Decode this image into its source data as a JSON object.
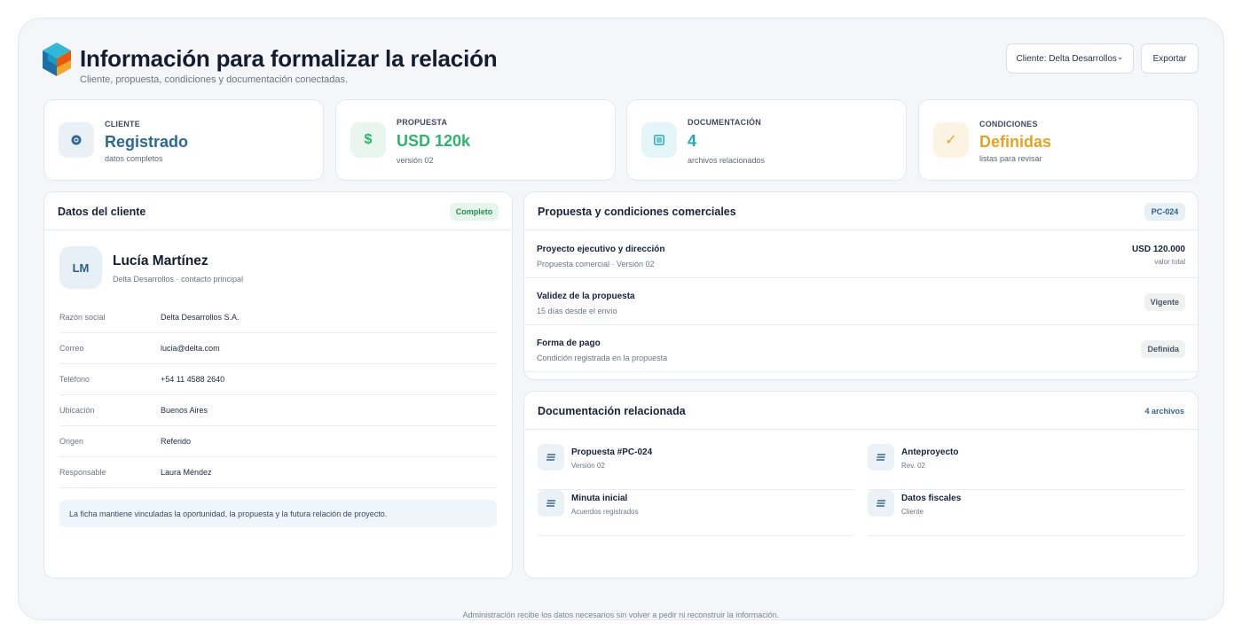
{
  "header": {
    "title": "Información para formalizar la relación",
    "subtitle": "Cliente, propuesta, condiciones y documentación conectadas.",
    "client_button": "Cliente: Delta Desarrollos",
    "client_chevron": "⌄",
    "export_button": "Exportar"
  },
  "stats": [
    {
      "label": "CLIENTE",
      "value": "Registrado",
      "sub": "datos completos",
      "icon": "eye-icon",
      "color": "#2c6a8f"
    },
    {
      "label": "PROPUESTA",
      "value": "USD 120k",
      "sub": "versión 02",
      "icon": "dollar-icon",
      "glyph": "$",
      "color": "#2db66b"
    },
    {
      "label": "DOCUMENTACIÓN",
      "value": "4",
      "sub": "archivos relacionados",
      "icon": "list-icon",
      "color": "#1fa9b8"
    },
    {
      "label": "CONDICIONES",
      "value": "Definidas",
      "sub": "listas para revisar",
      "icon": "check-icon",
      "glyph": "✓",
      "color": "#e6a322"
    }
  ],
  "client_card": {
    "title": "Datos del cliente",
    "badge": "Completo",
    "avatar": "LM",
    "name": "Lucía Martínez",
    "role": "Delta Desarrollos · contacto principal",
    "rows": [
      {
        "key": "Razón social",
        "value": "Delta Desarrollos S.A."
      },
      {
        "key": "Correo",
        "value": "lucia@delta.com"
      },
      {
        "key": "Teléfono",
        "value": "+54 11 4588 2640"
      },
      {
        "key": "Ubicación",
        "value": "Buenos Aires"
      },
      {
        "key": "Origen",
        "value": "Referido"
      },
      {
        "key": "Responsable",
        "value": "Laura Méndez"
      }
    ],
    "note": "La ficha mantiene vinculadas la oportunidad, la propuesta y la futura relación de proyecto."
  },
  "proposal_card": {
    "title": "Propuesta y condiciones comerciales",
    "badge": "PC-024",
    "rows": [
      {
        "title": "Proyecto ejecutivo y dirección",
        "sub": "Propuesta comercial · Versión 02",
        "amount": "USD 120.000",
        "amount_sub": "valor total"
      },
      {
        "title": "Validez de la propuesta",
        "sub": "15 días desde el envío",
        "tag": "Vigente"
      },
      {
        "title": "Forma de pago",
        "sub": "Condición registrada en la propuesta",
        "tag": "Definida"
      }
    ]
  },
  "docs_card": {
    "title": "Documentación relacionada",
    "count": "4 archivos",
    "items": [
      {
        "title": "Propuesta #PC-024",
        "sub": "Versión 02"
      },
      {
        "title": "Anteproyecto",
        "sub": "Rev. 02"
      },
      {
        "title": "Minuta inicial",
        "sub": "Acuerdos registrados"
      },
      {
        "title": "Datos fiscales",
        "sub": "Cliente"
      }
    ]
  },
  "footer": "Administración recibe los datos necesarios sin volver a pedir ni reconstruir la información."
}
